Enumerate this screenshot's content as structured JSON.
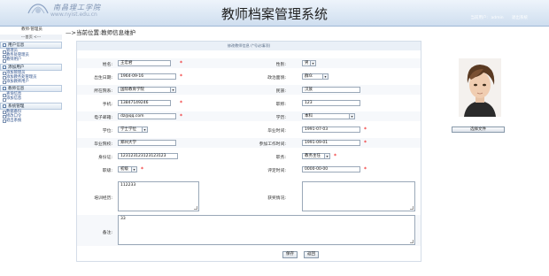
{
  "header": {
    "logo_text": "南昌理工学院",
    "logo_url": "www.nyist.edu.cn",
    "title": "教师档案管理系统",
    "user_label": "当前用户:",
    "user_name": "admin",
    "logout": "退出系统"
  },
  "sidebar": {
    "role": "教师·管理员",
    "home": "---首页 <---",
    "sections": [
      {
        "title": "用户信息",
        "items": [
          "管理员",
          "教务处管理员",
          "教师用户"
        ]
      },
      {
        "title": "添加用户",
        "items": [
          "添加管理员",
          "添加教务处管理员",
          "添加教师用户"
        ]
      },
      {
        "title": "教师信息",
        "items": [
          "查询信息",
          "添加信息"
        ]
      },
      {
        "title": "系统管理",
        "items": [
          "数据备份",
          "修改口令",
          "退出系统"
        ]
      }
    ]
  },
  "breadcrumb": "—>当前位置:教师信息维护",
  "form": {
    "caption": "修改教师信息 (*号必填项)",
    "name_label": "姓名:",
    "name_value": "王宏君",
    "gender_label": "性别:",
    "gender_value": "男",
    "birth_label": "出生日期:",
    "birth_value": "1964-09-16",
    "politics_label": "政治面貌:",
    "politics_value": "群众",
    "dept_label": "所在院系:",
    "dept_value": "国际教育学院",
    "nation_label": "民族:",
    "nation_value": "汉族",
    "phone_label": "手机:",
    "phone_value": "13847149246",
    "title_label": "职称:",
    "title_value": "123",
    "email_label": "电子邮箱:",
    "email_value": "dz@qq.com",
    "edu_label": "学历:",
    "edu_value": "本科",
    "degree_label": "学位:",
    "degree_value": "学士学位",
    "grad_time_label": "毕业时间:",
    "grad_time_value": "1991-07-03",
    "school_label": "毕业院校:",
    "school_value": "郑州大学",
    "work_time_label": "参加工作时间:",
    "work_time_value": "1991-09-01",
    "id_label": "身份证:",
    "id_value": "123123123123123123",
    "post_label": "职务:",
    "post_value": "教务主任",
    "rank_label": "职级:",
    "rank_value": "初级",
    "eval_label": "评定时间:",
    "eval_value": "0000-00-00",
    "train_label": "培训经历:",
    "train_value": "112233",
    "award_label": "获奖情况:",
    "award_value": "",
    "note_label": "备注:",
    "note_value": "33",
    "save": "保存",
    "back": "返回",
    "file_button": "选择文件",
    "required_mark": "*",
    "arrow": "▾"
  },
  "colors": {
    "accent": "#2a4e8a",
    "required": "#ee0000",
    "header_bg": "#dbe7f4"
  }
}
